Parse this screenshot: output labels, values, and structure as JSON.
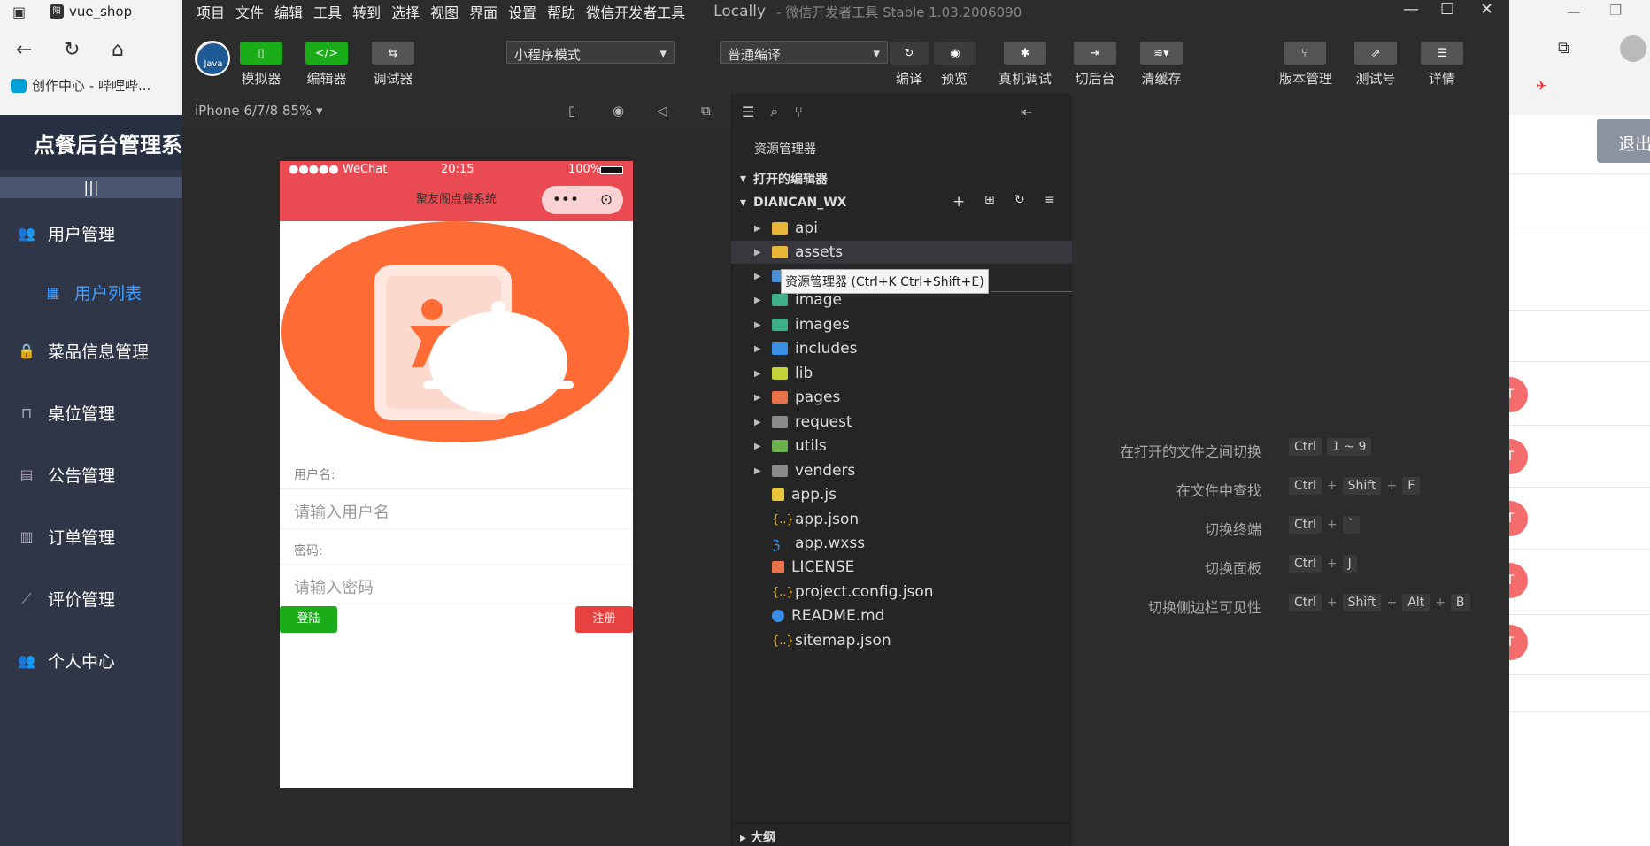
{
  "browser": {
    "tab_title": "vue_shop",
    "tab_favicon": "阳",
    "bookmark": "创作中心 - 哔哩哔..."
  },
  "admin": {
    "title": "点餐后台管理系",
    "toggle": "|||",
    "logout": "退出",
    "menu": [
      {
        "label": "用户管理",
        "icon": "users-icon"
      },
      {
        "label": "用户列表",
        "icon": "grid-icon"
      },
      {
        "label": "菜品信息管理",
        "icon": "bag-icon"
      },
      {
        "label": "桌位管理",
        "icon": "table-icon"
      },
      {
        "label": "公告管理",
        "icon": "clipboard-icon"
      },
      {
        "label": "订单管理",
        "icon": "order-icon"
      },
      {
        "label": "评价管理",
        "icon": "chart-icon"
      },
      {
        "label": "个人中心",
        "icon": "users-icon"
      }
    ],
    "row_dot": "T"
  },
  "devtools": {
    "menus": [
      "项目",
      "文件",
      "编辑",
      "工具",
      "转到",
      "选择",
      "视图",
      "界面",
      "设置",
      "帮助",
      "微信开发者工具"
    ],
    "title": "Locally",
    "subtitle": "- 微信开发者工具 Stable 1.03.2006090",
    "avatar_text": "Java",
    "toolbar": {
      "sim": "模拟器",
      "editor": "编辑器",
      "debug": "调试器",
      "mode": "小程序模式",
      "compile_mode": "普通编译",
      "compile": "编译",
      "preview": "预览",
      "real_debug": "真机调试",
      "backend": "切后台",
      "cache": "清缓存",
      "version": "版本管理",
      "test": "测试号",
      "detail": "详情"
    },
    "device": "iPhone 6/7/8 85% ▾"
  },
  "phone": {
    "signal": "●●●●● WeChat",
    "time": "20:15",
    "battery": "100%",
    "nav_title": "聚友阁点餐系统",
    "capsule_more": "•••",
    "capsule_close": "⊙",
    "user_label": "用户名:",
    "user_placeholder": "请输入用户名",
    "pwd_label": "密码:",
    "pwd_placeholder": "请输入密码",
    "login": "登陆",
    "register": "注册"
  },
  "explorer": {
    "header": "资源管理器",
    "open_editors": "打开的编辑器",
    "project": "DIANCAN_WX",
    "tooltip": "资源管理器 (Ctrl+K Ctrl+Shift+E)",
    "outline": "大纲",
    "items": [
      {
        "name": "api",
        "color": "#e8b73a"
      },
      {
        "name": "assets",
        "color": "#e8b73a"
      },
      {
        "name": "",
        "color": "#4a90d9"
      },
      {
        "name": "image",
        "color": "#3fae8a"
      },
      {
        "name": "images",
        "color": "#3fae8a"
      },
      {
        "name": "includes",
        "color": "#3a8ee6"
      },
      {
        "name": "lib",
        "color": "#c5d23a"
      },
      {
        "name": "pages",
        "color": "#e8734a"
      },
      {
        "name": "request",
        "color": "#8a8a8a"
      },
      {
        "name": "utils",
        "color": "#6ab04c"
      },
      {
        "name": "venders",
        "color": "#8a8a8a"
      },
      {
        "name": "app.js",
        "color": "#e8c53a"
      },
      {
        "name": "app.json",
        "color": "#e8b73a"
      },
      {
        "name": "app.wxss",
        "color": "#3a8ee6"
      },
      {
        "name": "LICENSE",
        "color": "#e8734a"
      },
      {
        "name": "project.config.json",
        "color": "#e8b73a"
      },
      {
        "name": "README.md",
        "color": "#3a8ee6"
      },
      {
        "name": "sitemap.json",
        "color": "#e8b73a"
      }
    ]
  },
  "shortcuts": [
    {
      "label": "在打开的文件之间切换",
      "keys": [
        "Ctrl",
        "1 ~ 9"
      ]
    },
    {
      "label": "在文件中查找",
      "keys": [
        "Ctrl",
        "+",
        "Shift",
        "+",
        "F"
      ]
    },
    {
      "label": "切换终端",
      "keys": [
        "Ctrl",
        "+",
        "`"
      ]
    },
    {
      "label": "切换面板",
      "keys": [
        "Ctrl",
        "+",
        "J"
      ]
    },
    {
      "label": "切换侧边栏可见性",
      "keys": [
        "Ctrl",
        "+",
        "Shift",
        "+",
        "Alt",
        "+",
        "B"
      ]
    }
  ]
}
